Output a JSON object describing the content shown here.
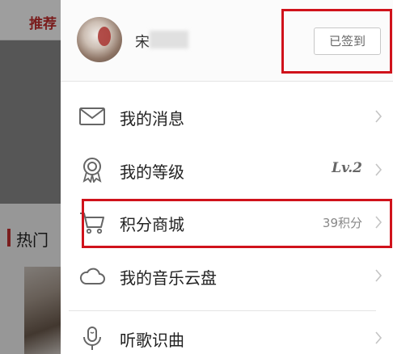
{
  "background": {
    "tab_label": "推荐",
    "section_title": "热门"
  },
  "header": {
    "username": "宋",
    "signin_label": "已签到"
  },
  "menu": {
    "items": [
      {
        "label": "我的消息",
        "meta": "",
        "icon": "envelope-icon"
      },
      {
        "label": "我的等级",
        "meta": "Lv.2",
        "icon": "medal-icon"
      },
      {
        "label": "积分商城",
        "meta": "39积分",
        "icon": "cart-icon"
      },
      {
        "label": "我的音乐云盘",
        "meta": "",
        "icon": "cloud-icon"
      },
      {
        "label": "听歌识曲",
        "meta": "",
        "icon": "microphone-icon"
      }
    ]
  },
  "colors": {
    "brand_red": "#c62f2f",
    "highlight_red": "#d0121b",
    "text": "#222222",
    "muted": "#888888"
  }
}
